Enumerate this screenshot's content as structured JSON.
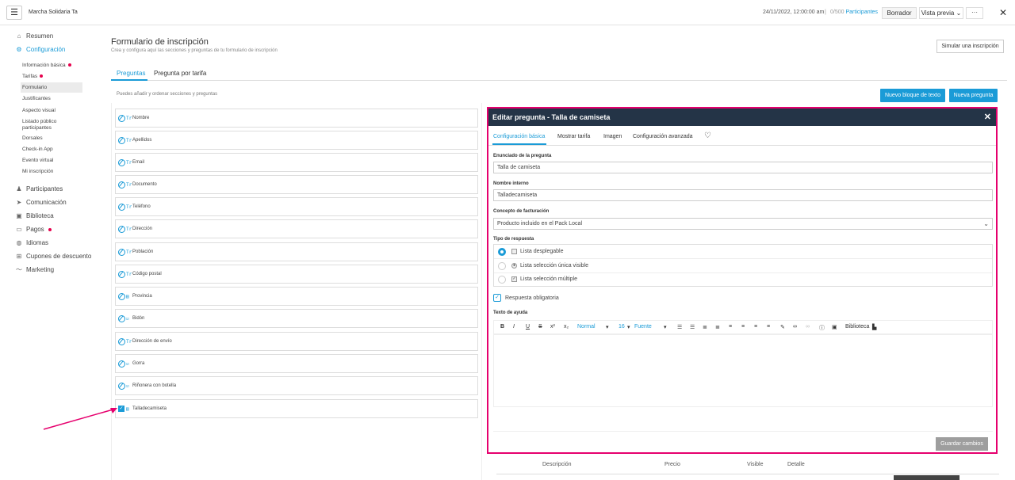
{
  "topbar": {
    "menu_icon": "hamburger-icon",
    "event_name": "Marcha Solidaria Ta",
    "date": "24/11/2022, 12:00:00 am",
    "sep": "|",
    "participants_count": "0/500",
    "participants_label": "Participantes",
    "draft_label": "Borrador",
    "preview_label": "Vista previa",
    "more_label": "···",
    "close_label": "✕"
  },
  "sidebar": {
    "items": [
      {
        "label": "Resumen",
        "icon": "home-icon"
      },
      {
        "label": "Configuración",
        "icon": "gear-icon"
      },
      {
        "label": "Participantes",
        "icon": "person-icon"
      },
      {
        "label": "Comunicación",
        "icon": "send-icon"
      },
      {
        "label": "Biblioteca",
        "icon": "images-icon"
      },
      {
        "label": "Pagos",
        "icon": "card-icon"
      },
      {
        "label": "Idiomas",
        "icon": "globe-icon"
      },
      {
        "label": "Cupones de descuento",
        "icon": "plus-box-icon"
      },
      {
        "label": "Marketing",
        "icon": "chart-icon"
      }
    ],
    "subitems": [
      "Información básica",
      "Tarifas",
      "Formulario",
      "Justificantes",
      "Aspecto visual",
      "Listado público participantes",
      "Dorsales",
      "Check-in App",
      "Evento virtual",
      "Mi inscripción"
    ]
  },
  "main": {
    "title": "Formulario de inscripción",
    "subtitle": "Crea y configura aquí las secciones y preguntas de tu formulario de inscripción",
    "simulate_label": "Simular una inscripción",
    "tabs": [
      "Preguntas",
      "Pregunta por tarifa"
    ],
    "hint": "Puedes añadir y ordenar secciones y preguntas",
    "new_text_block": "Nuevo bloque de texto",
    "new_question": "Nueva pregunta",
    "questions": [
      {
        "label": "Nombre",
        "type": "Tr"
      },
      {
        "label": "Apellidos",
        "type": "Tr"
      },
      {
        "label": "Email",
        "type": "Tr"
      },
      {
        "label": "Documento",
        "type": "Tr"
      },
      {
        "label": "Teléfono",
        "type": "Tr"
      },
      {
        "label": "Dirección",
        "type": "Tr"
      },
      {
        "label": "Población",
        "type": "Tr"
      },
      {
        "label": "Código postal",
        "type": "Tr"
      },
      {
        "label": "Provincia",
        "type": "▤"
      },
      {
        "label": "Bidón",
        "type": "☑"
      },
      {
        "label": "Dirección de envío",
        "type": "Tr"
      },
      {
        "label": "Gorra",
        "type": "☑"
      },
      {
        "label": "Riñonera con botella",
        "type": "☑"
      },
      {
        "label": "Talladecamiseta",
        "type": "▤"
      }
    ]
  },
  "editor": {
    "title": "Editar pregunta - Talla de camiseta",
    "close": "✕",
    "tabs": [
      "Configuración básica",
      "Mostrar tarifa",
      "Imagen",
      "Configuración avanzada",
      "♡"
    ],
    "statement_label": "Enunciado de la pregunta",
    "statement_value": "Talla de camiseta",
    "internal_label": "Nombre interno",
    "internal_value": "Talladecamiseta",
    "billing_label": "Concepto de facturación",
    "billing_value": "Producto incluido en el Pack Local",
    "caret": "⌄",
    "answer_type_label": "Tipo de respuesta",
    "answer_types": [
      "Lista desplegable",
      "Lista selección única visible",
      "Lista selección múltiple"
    ],
    "mandatory_label": "Respuesta obligatoria",
    "help_label": "Texto de ayuda",
    "toolbar": {
      "bold": "B",
      "italic": "I",
      "underline": "U",
      "strike": "S",
      "sup": "x²",
      "sub": "x₂",
      "format": "Normal",
      "size": "16",
      "font": "Fuente",
      "library": "Biblioteca"
    },
    "save_label": "Guardar cambios"
  },
  "table": {
    "columns": [
      "Descripción",
      "Precio",
      "Visible",
      "Detalle"
    ]
  }
}
